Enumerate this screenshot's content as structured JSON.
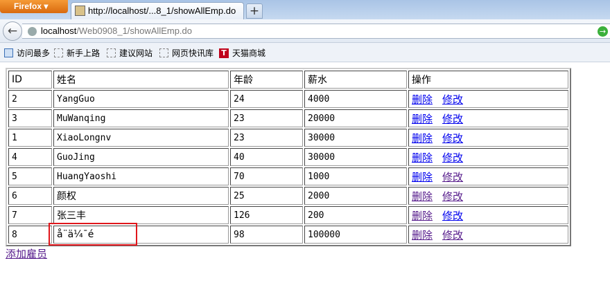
{
  "browser": {
    "menu_button": "Firefox ▾",
    "tab_title": "http://localhost/...8_1/showAllEmp.do",
    "url_host": "localhost",
    "url_path": "/Web0908_1/showAllEmp.do",
    "new_tab": "+",
    "back": "←",
    "go": "→"
  },
  "bookmarks": [
    {
      "label": "访问最多",
      "icon": "most-visited"
    },
    {
      "label": "新手上路",
      "icon": "page"
    },
    {
      "label": "建议网站",
      "icon": "page"
    },
    {
      "label": "网页快讯库",
      "icon": "page"
    },
    {
      "label": "天猫商城",
      "icon": "tmall",
      "icon_text": "T"
    }
  ],
  "table": {
    "headers": [
      "ID",
      "姓名",
      "年龄",
      "薪水",
      "操作"
    ],
    "delete_label": "删除",
    "edit_label": "修改",
    "rows": [
      {
        "id": "2",
        "name": "YangGuo",
        "age": "24",
        "salary": "4000",
        "delete_visited": false,
        "edit_visited": false
      },
      {
        "id": "3",
        "name": "MuWanqing",
        "age": "23",
        "salary": "20000",
        "delete_visited": false,
        "edit_visited": false
      },
      {
        "id": "1",
        "name": "XiaoLongnv",
        "age": "23",
        "salary": "30000",
        "delete_visited": false,
        "edit_visited": false
      },
      {
        "id": "4",
        "name": "GuoJing",
        "age": "40",
        "salary": "30000",
        "delete_visited": false,
        "edit_visited": false
      },
      {
        "id": "5",
        "name": "HuangYaoshi",
        "age": "70",
        "salary": "1000",
        "delete_visited": false,
        "edit_visited": true
      },
      {
        "id": "6",
        "name": "颜权",
        "age": "25",
        "salary": "2000",
        "delete_visited": true,
        "edit_visited": true
      },
      {
        "id": "7",
        "name": "张三丰",
        "age": "126",
        "salary": "200",
        "delete_visited": true,
        "edit_visited": false
      },
      {
        "id": "8",
        "name": "å¨ä¼¯é",
        "age": "98",
        "salary": "100000",
        "delete_visited": true,
        "edit_visited": true
      }
    ]
  },
  "add_link": "添加雇员",
  "highlight_color": "#e0161b"
}
